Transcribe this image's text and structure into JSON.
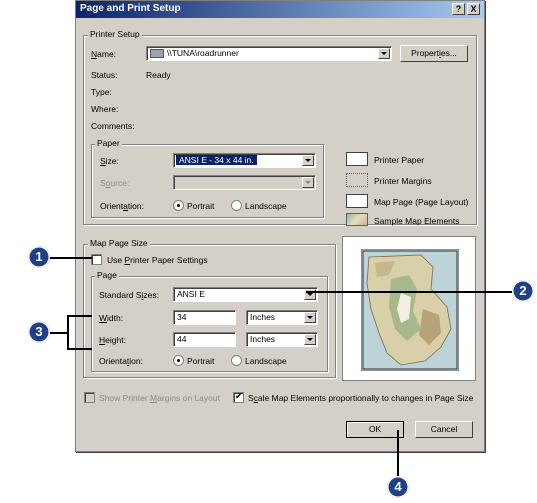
{
  "dialog": {
    "title": "Page and Print Setup",
    "help_button": "?",
    "close_button": "X"
  },
  "printer_setup": {
    "legend": "Printer Setup",
    "name_label": "Name:",
    "name_value": "\\\\TUNA\\roadrunner",
    "properties_button": "Properties...",
    "status_label": "Status:",
    "status_value": "Ready",
    "type_label": "Type:",
    "where_label": "Where:",
    "comments_label": "Comments:"
  },
  "paper": {
    "legend": "Paper",
    "size_label": "Size:",
    "size_value": "ANSI E - 34 x 44 in.",
    "source_label": "Source:",
    "source_value": "",
    "orientation_label": "Orientation:",
    "portrait_label": "Portrait",
    "landscape_label": "Landscape",
    "orientation_selected": "Portrait"
  },
  "legend_items": [
    {
      "label": "Printer Paper"
    },
    {
      "label": "Printer Margins"
    },
    {
      "label": "Map Page (Page Layout)"
    },
    {
      "label": "Sample Map Elements"
    }
  ],
  "map_page_size": {
    "legend": "Map Page Size",
    "use_printer_settings_label": "Use Printer Paper Settings",
    "use_printer_settings_checked": false,
    "page": {
      "legend": "Page",
      "standard_sizes_label": "Standard Sizes:",
      "standard_sizes_value": "ANSI E",
      "width_label": "Width:",
      "width_value": "34",
      "width_unit": "Inches",
      "height_label": "Height:",
      "height_value": "44",
      "height_unit": "Inches",
      "orientation_label": "Orientation:",
      "portrait_label": "Portrait",
      "landscape_label": "Landscape",
      "orientation_selected": "Portrait"
    }
  },
  "bottom": {
    "show_margins_label": "Show Printer Margins on Layout",
    "show_margins_checked": false,
    "scale_elements_label": "Scale Map Elements proportionally to changes in Page Size",
    "scale_elements_checked": true,
    "ok_button": "OK",
    "cancel_button": "Cancel"
  },
  "callouts": [
    "1",
    "2",
    "3",
    "4"
  ],
  "colors": {
    "title_gradient_start": "#0a246a",
    "title_gradient_end": "#a6caf0",
    "window_face": "#d4d0c8",
    "callout": "#1f3f86"
  }
}
